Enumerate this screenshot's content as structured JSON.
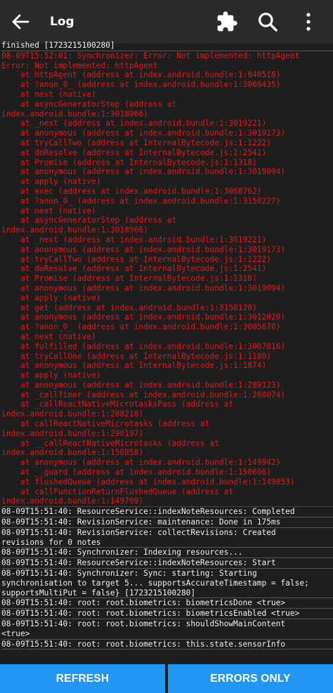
{
  "app_bar": {
    "title": "Log",
    "back_icon": "arrow-left-icon",
    "actions": [
      "puzzle-icon",
      "search-icon",
      "more-vertical-icon"
    ]
  },
  "log": {
    "first_line": "finished [1723215100280]",
    "error_entry": "08-09T15:52:01: Synchronizer: Error: Not implemented: httpAgent\nError: Not implemented: httpAgent\n    at httpAgent (address at index.android.bundle:1:840518)\n    at ?anon_0_ (address at index.android.bundle:1:3069435)\n    at next (native)\n    at asyncGeneratorStep (address at\nindex.android.bundle:1:3018966)\n    at _next (address at index.android.bundle:1:3019221)\n    at anonymous (address at index.android.bundle:1:3019173)\n    at tryCallTwo (address at InternalBytecode.js:1:1222)\n    at doResolve (address at InternalBytecode.js:1:2541)\n    at Promise (address at InternalBytecode.js:1:1318)\n    at anonymous (address at index.android.bundle:1:3019094)\n    at apply (native)\n    at exec (address at index.android.bundle:1:3068762)\n    at ?anon_0_ (address at index.android.bundle:1:3150227)\n    at next (native)\n    at asyncGeneratorStep (address at\nindex.android.bundle:1:3018966)\n    at _next (address at index.android.bundle:1:3019221)\n    at anonymous (address at index.android.bundle:1:3019173)\n    at tryCallTwo (address at InternalBytecode.js:1:1222)\n    at doResolve (address at InternalBytecode.js:1:2541)\n    at Promise (address at InternalBytecode.js:1:1318)\n    at anonymous (address at index.android.bundle:1:3019094)\n    at apply (native)\n    at get (address at index.android.bundle:1:3150120)\n    at anonymous (address at index.android.bundle:1:3012020)\n    at ?anon_0_ (address at index.android.bundle:1:3005670)\n    at next (native)\n    at fulfilled (address at index.android.bundle:1:3007816)\n    at tryCallOne (address at InternalBytecode.js:1:1180)\n    at anonymous (address at InternalBytecode.js:1:1874)\n    at apply (native)\n    at anonymous (address at index.android.bundle:1:289123)\n    at _callTimer (address at index.android.bundle:1:288074)\n    at _callReactNativeMicrotasksPass (address at\nindex.android.bundle:1:288218)\n    at callReactNativeMicrotasks (address at\nindex.android.bundle:1:290197)\n    at __callReactNativeMicrotasks (address at\nindex.android.bundle:1:150858)\n    at anonymous (address at index.android.bundle:1:149942)\n    at __guard (address at index.android.bundle:1:150696)\n    at flushedQueue (address at index.android.bundle:1:149853)\n    at callFunctionReturnFlushedQueue (address at\nindex.android.bundle:1:149709)",
    "entries": [
      "08-09T15:51:40: ResourceService::indexNoteResources: Completed",
      "08-09T15:51:40: RevisionService: maintenance: Done in 175ms",
      "08-09T15:51:40: RevisionService: collectRevisions: Created\nrevisions for 0 notes",
      "08-09T15:51:40: Synchronizer: Indexing resources...",
      "08-09T15:51:40: ResourceService::indexNoteResources: Start",
      "08-09T15:51:40: Synchronizer: Sync: starting: Starting\nsynchronisation to target 5... supportsAccurateTimestamp = false;\nsupportsMultiPut = false} [1723215100280]",
      "08-09T15:51:40: root: root.biometrics: biometricsDone <true>",
      "08-09T15:51:40: root: root.biometrics: biometricsEnabled <true>",
      "08-09T15:51:40: root: root.biometrics: shouldShowMainContent\n<true>",
      "08-09T15:51:40: root: root.biometrics: this.state.sensorInfo"
    ]
  },
  "footer": {
    "refresh_label": "REFRESH",
    "errors_only_label": "ERRORS ONLY"
  },
  "colors": {
    "app_bar": "#2b2b2b",
    "background": "#1e1e1e",
    "error_text": "#e0141e",
    "info_text": "#f0f0f0",
    "button": "#2196f3"
  }
}
